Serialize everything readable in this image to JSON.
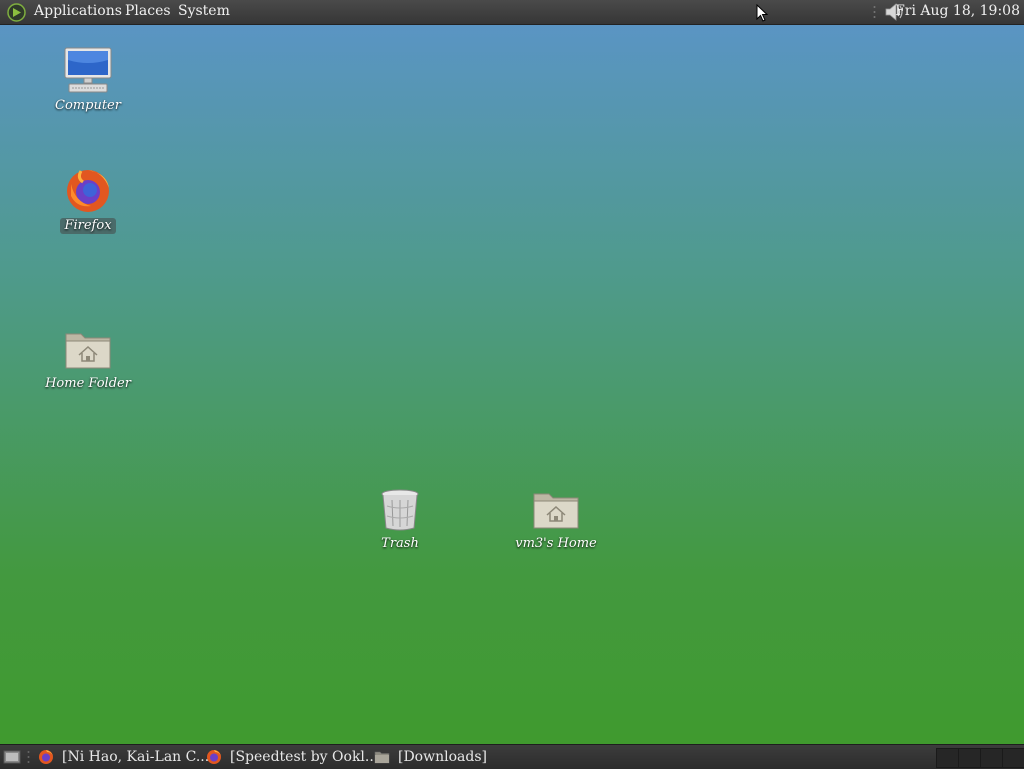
{
  "top_panel": {
    "menus": [
      "Applications",
      "Places",
      "System"
    ],
    "clock": "Fri Aug 18, 19:08",
    "tray_icons": [
      "volume-icon"
    ]
  },
  "desktop": {
    "icons": [
      {
        "label": "Computer",
        "icon": "computer-icon"
      },
      {
        "label": "Firefox",
        "icon": "firefox-icon"
      },
      {
        "label": "Home Folder",
        "icon": "home-folder-icon"
      },
      {
        "label": "Trash",
        "icon": "trash-icon"
      },
      {
        "label": "vm3's Home",
        "icon": "home-folder-icon"
      }
    ],
    "selected_icon": "Firefox"
  },
  "taskbar": {
    "tasks": [
      {
        "label": "[Ni Hao, Kai-Lan C...",
        "icon": "firefox-icon"
      },
      {
        "label": "[Speedtest by Ookl...",
        "icon": "firefox-icon"
      },
      {
        "label": "[Downloads]",
        "icon": "folder-icon"
      }
    ],
    "workspaces": 4
  },
  "colors": {
    "panel": "#3a3a3a",
    "desktop_top": "#5b94c9",
    "desktop_bottom": "#3f9a2c"
  }
}
